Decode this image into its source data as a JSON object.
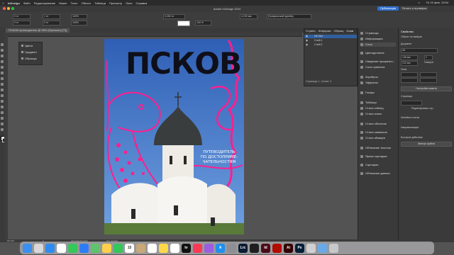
{
  "menubar": {
    "apple": "",
    "items": [
      "InDesign",
      "Файл",
      "Редактирование",
      "Макет",
      "Текст",
      "Объект",
      "Таблица",
      "Просмотр",
      "Окно",
      "Справка"
    ],
    "right": [
      "Пт 22 фев. 19:54"
    ]
  },
  "window": {
    "title": "Adobe InDesign 2024",
    "publish_label": "Публикация",
    "print_label": "Печать и проверка"
  },
  "control": {
    "zoom": "100%",
    "font": "[Графический фрейм]",
    "stroke": "0,283 пт",
    "opacity": "100 %",
    "size": "4,233 мм",
    "ref": "1 пт",
    "x_field": "0 пт",
    "y_field": "0 пт"
  },
  "document": {
    "tab_label": "ПСКОВ путеводитель @ 96% [Просмотр [Т]]"
  },
  "swatch_popup": {
    "items": [
      "Цвета",
      "Градиент",
      "Образцы"
    ]
  },
  "poster": {
    "title": "ПСКОВ",
    "subtitle_lines": [
      "ПУТЕВОДИТЕЛЬ",
      "ПО ДОСТОПРИМЕ-",
      "ЧАТЕЛЬНОСТЯМ"
    ],
    "colors": {
      "sky": "#3f6ec0",
      "pink": "#ff1f8e",
      "title": "#0f0f1a",
      "wall": "#f4f2ee",
      "dome": "#3a3d3e"
    }
  },
  "layers_panel": {
    "tabs": [
      "Страни",
      "Информа",
      "Образц",
      "Слои"
    ],
    "layers": [
      "Н8 ЛАХ",
      "Слой 1",
      "Слой 2"
    ],
    "status": "Страница: 1, Слоев: 3"
  },
  "mid_panel": {
    "items": [
      "Страницы",
      "Информация",
      "Слои",
      "Цветоделение",
      "Сведение прозрачно...",
      "Слои трапинга",
      "Атрибуты",
      "Эффекты",
      "Глифы",
      "Таблица",
      "Стили таблиц",
      "Стили ячеек",
      "Стили объектов",
      "Стили символов",
      "Стили абзацев",
      "Обтекание текстом",
      "Ярлык сценария",
      "Сценарии",
      "Обтекание данных"
    ]
  },
  "right_panel": {
    "header": "Свойства",
    "no_select": "Объект не выбран",
    "document_label": "Документ",
    "page_size": "A5",
    "width": "148 мм",
    "height": "210 мм",
    "pages": "1",
    "orientation_label": "Поворот",
    "fields_label": "Поля",
    "adjust_button": "Настройка макета",
    "guides_label": "Страница",
    "edit_page_button": "Редактировать стр.",
    "ruler_label": "Линейки и сетки",
    "guides": "Направляющие",
    "quick_actions": "Быстрые действия",
    "import_button": "Импорт файла"
  },
  "status": {
    "zoom": "96,44%",
    "page": "1",
    "info": "[Основной] (раб.)",
    "errors": "Нет ошибок"
  },
  "dock": {
    "apps": [
      {
        "name": "finder",
        "color": "#3b8ff0",
        "label": ""
      },
      {
        "name": "launchpad",
        "color": "#d8d8d8",
        "label": ""
      },
      {
        "name": "safari",
        "color": "#2e8bf0",
        "label": ""
      },
      {
        "name": "chrome",
        "color": "#ffffff",
        "label": ""
      },
      {
        "name": "messages",
        "color": "#35c759",
        "label": ""
      },
      {
        "name": "mail",
        "color": "#2d7cf6",
        "label": ""
      },
      {
        "name": "maps",
        "color": "#5fc36b",
        "label": ""
      },
      {
        "name": "photos",
        "color": "#ffd04a",
        "label": ""
      },
      {
        "name": "facetime",
        "color": "#34c759",
        "label": ""
      },
      {
        "name": "calendar",
        "color": "#ffffff",
        "label": "15"
      },
      {
        "name": "contacts",
        "color": "#c8a878",
        "label": ""
      },
      {
        "name": "reminders",
        "color": "#ffffff",
        "label": ""
      },
      {
        "name": "notes",
        "color": "#ffd84a",
        "label": ""
      },
      {
        "name": "freeform",
        "color": "#ffffff",
        "label": ""
      },
      {
        "name": "tv",
        "color": "#111111",
        "label": "tv"
      },
      {
        "name": "music",
        "color": "#fa3a55",
        "label": ""
      },
      {
        "name": "podcasts",
        "color": "#9b5ee0",
        "label": ""
      },
      {
        "name": "appstore",
        "color": "#1f8ff0",
        "label": "A"
      },
      {
        "name": "settings",
        "color": "#8e8e93",
        "label": ""
      },
      {
        "name": "lightroom",
        "color": "#0b1c33",
        "label": "Lrc"
      },
      {
        "name": "figma",
        "color": "#1e1e1e",
        "label": ""
      },
      {
        "name": "indesign",
        "color": "#4b0a18",
        "label": "Id"
      },
      {
        "name": "acrobat",
        "color": "#b30b00",
        "label": ""
      },
      {
        "name": "illustrator",
        "color": "#330000",
        "label": "Ai"
      },
      {
        "name": "photoshop",
        "color": "#001e36",
        "label": "Ps"
      },
      {
        "name": "preview",
        "color": "#d0d0d0",
        "label": ""
      },
      {
        "name": "folder",
        "color": "#6aa9e8",
        "label": ""
      },
      {
        "name": "trash",
        "color": "#c7c7cc",
        "label": ""
      }
    ]
  }
}
